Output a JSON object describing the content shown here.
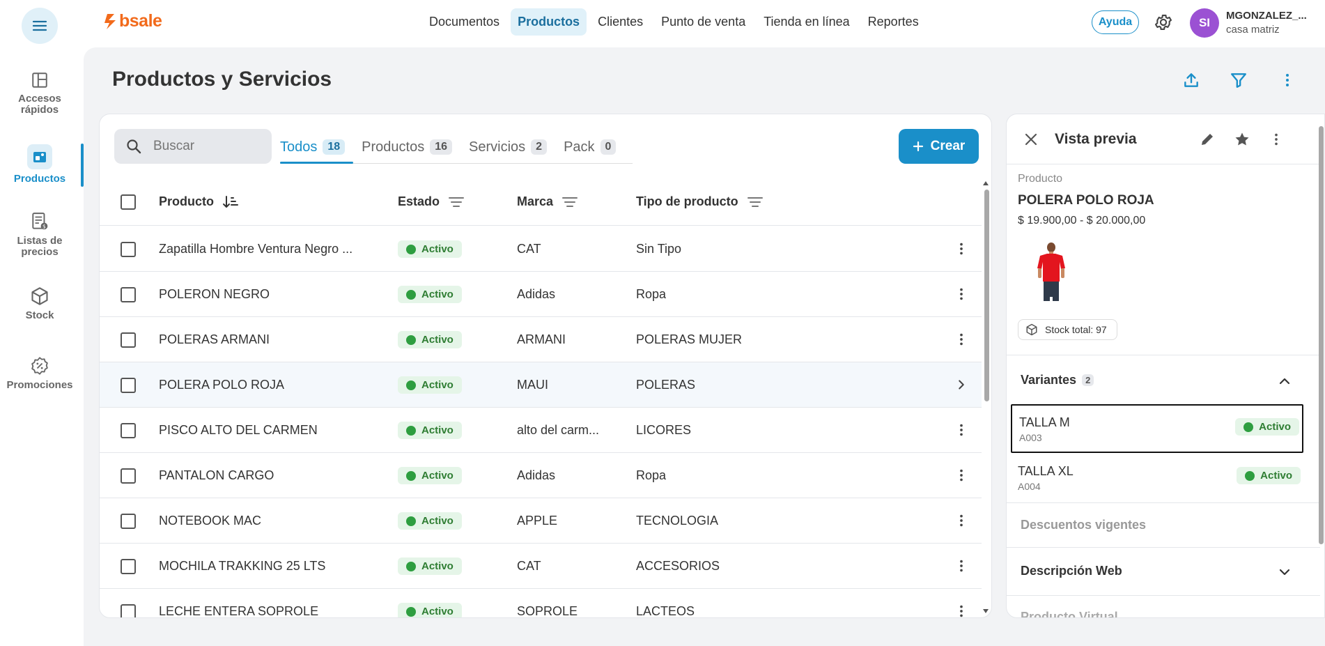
{
  "topbar": {
    "logo": "bsale",
    "nav": [
      "Documentos",
      "Productos",
      "Clientes",
      "Punto de venta",
      "Tienda en línea",
      "Reportes"
    ],
    "active_nav": "Productos",
    "help_label": "Ayuda",
    "avatar_initials": "SI",
    "user_name": "MGONZALEZ_...",
    "user_branch": "casa matriz"
  },
  "sidebar": {
    "items": [
      {
        "label": "Accesos rápidos",
        "icon": "layout-icon"
      },
      {
        "label": "Productos",
        "icon": "products-icon",
        "active": true
      },
      {
        "label": "Listas de precios",
        "icon": "price-list-icon"
      },
      {
        "label": "Stock",
        "icon": "cube-icon"
      },
      {
        "label": "Promociones",
        "icon": "discount-icon"
      }
    ]
  },
  "page": {
    "title": "Productos y Servicios"
  },
  "toolbar": {
    "search_placeholder": "Buscar",
    "tabs": [
      {
        "label": "Todos",
        "count": "18",
        "active": true
      },
      {
        "label": "Productos",
        "count": "16"
      },
      {
        "label": "Servicios",
        "count": "2"
      },
      {
        "label": "Pack",
        "count": "0"
      }
    ],
    "create_label": "Crear"
  },
  "table": {
    "columns": [
      "Producto",
      "Estado",
      "Marca",
      "Tipo de producto"
    ],
    "rows": [
      {
        "producto": "Zapatilla Hombre Ventura Negro ...",
        "estado": "Activo",
        "marca": "CAT",
        "tipo": "Sin Tipo"
      },
      {
        "producto": "POLERON NEGRO",
        "estado": "Activo",
        "marca": "Adidas",
        "tipo": "Ropa"
      },
      {
        "producto": "POLERAS ARMANI",
        "estado": "Activo",
        "marca": "ARMANI",
        "tipo": "POLERAS MUJER"
      },
      {
        "producto": "POLERA POLO ROJA",
        "estado": "Activo",
        "marca": "MAUI",
        "tipo": "POLERAS",
        "selected": true
      },
      {
        "producto": "PISCO ALTO DEL CARMEN",
        "estado": "Activo",
        "marca": "alto del carm...",
        "tipo": "LICORES"
      },
      {
        "producto": "PANTALON CARGO",
        "estado": "Activo",
        "marca": "Adidas",
        "tipo": "Ropa"
      },
      {
        "producto": "NOTEBOOK MAC",
        "estado": "Activo",
        "marca": "APPLE",
        "tipo": "TECNOLOGIA"
      },
      {
        "producto": "MOCHILA TRAKKING 25 LTS",
        "estado": "Activo",
        "marca": "CAT",
        "tipo": "ACCESORIOS"
      },
      {
        "producto": "LECHE ENTERA SOPROLE",
        "estado": "Activo",
        "marca": "SOPROLE",
        "tipo": "LACTEOS"
      }
    ]
  },
  "preview": {
    "title": "Vista previa",
    "type_label": "Producto",
    "product_name": "POLERA POLO ROJA",
    "price_range": "$ 19.900,00 - $ 20.000,00",
    "stock_label": "Stock total: 97",
    "variants_title": "Variantes",
    "variants_count": "2",
    "variants": [
      {
        "name": "TALLA M",
        "code": "A003",
        "status": "Activo"
      },
      {
        "name": "TALLA XL",
        "code": "A004",
        "status": "Activo"
      }
    ],
    "discounts_title": "Descuentos vigentes",
    "web_desc_title": "Descripción Web",
    "virtual_title": "Producto Virtual"
  },
  "colors": {
    "accent": "#1a8fc9",
    "brand": "#f26a1b",
    "active_badge_bg": "#e5f5e8",
    "active_badge_dot": "#2e9e40",
    "avatar": "#9b51d3"
  }
}
